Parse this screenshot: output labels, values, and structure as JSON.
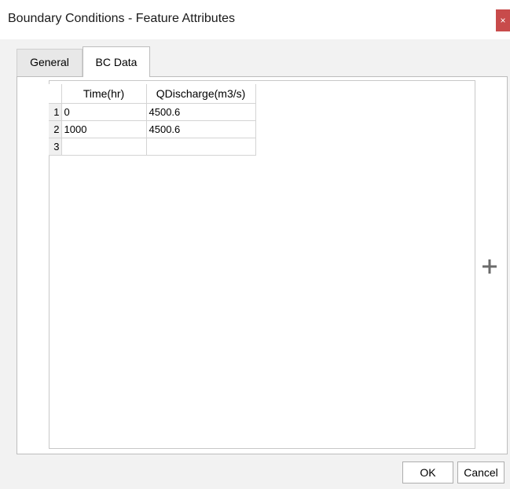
{
  "window": {
    "title": "Boundary Conditions - Feature Attributes",
    "close_label": "×"
  },
  "tabs": [
    {
      "label": "General",
      "active": false
    },
    {
      "label": "BC Data",
      "active": true
    }
  ],
  "table": {
    "columns": [
      "Time(hr)",
      "QDischarge(m3/s)"
    ],
    "rows": [
      {
        "num": "1",
        "time": "0",
        "q": "4500.6"
      },
      {
        "num": "2",
        "time": "1000",
        "q": "4500.6"
      },
      {
        "num": "3",
        "time": "",
        "q": ""
      }
    ]
  },
  "side": {
    "add_icon": "plus-icon"
  },
  "footer": {
    "ok_label": "OK",
    "cancel_label": "Cancel"
  },
  "colors": {
    "close_button": "#c84b4b",
    "dialog_bg": "#f2f2f2",
    "add_icon": "#6b6b6b"
  }
}
